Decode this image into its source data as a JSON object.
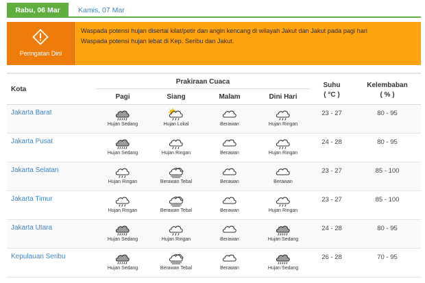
{
  "tabs": [
    {
      "label": "Rabu, 06 Mar",
      "active": true
    },
    {
      "label": "Kamis, 07 Mar",
      "active": false
    }
  ],
  "alert": {
    "label": "Peringatan Dini",
    "icon": "warning-icon",
    "lines": [
      "Waspada potensi hujan disertai kilat/petir dan angin kencang di wilayah Jakut dan Jakut pada pagi hari",
      "Waspada potensi hujan lebat di Kep. Seribu dan Jakut."
    ]
  },
  "table": {
    "headers": {
      "city": "Kota",
      "forecast": "Prakiraan Cuaca",
      "periods": [
        "Pagi",
        "Siang",
        "Malam",
        "Dini Hari"
      ],
      "temp": "Suhu",
      "temp_unit": "( °C )",
      "humidity": "Kelembaban",
      "humidity_unit": "( % )"
    },
    "rows": [
      {
        "city": "Jakarta Barat",
        "forecast": [
          {
            "icon": "heavy-rain",
            "label": "Hujan Sedang"
          },
          {
            "icon": "sun-rain",
            "label": "Hujan Lokal"
          },
          {
            "icon": "cloud",
            "label": "Berawan"
          },
          {
            "icon": "light-rain",
            "label": "Hujan Ringan"
          }
        ],
        "temp": "23 - 27",
        "humidity": "80 - 95"
      },
      {
        "city": "Jakarta Pusat",
        "forecast": [
          {
            "icon": "heavy-rain",
            "label": "Hujan Sedang"
          },
          {
            "icon": "light-rain",
            "label": "Hujan Ringan"
          },
          {
            "icon": "cloud",
            "label": "Berawan"
          },
          {
            "icon": "light-rain",
            "label": "Hujan Ringan"
          }
        ],
        "temp": "24 - 28",
        "humidity": "80 - 95"
      },
      {
        "city": "Jakarta Selatan",
        "forecast": [
          {
            "icon": "light-rain",
            "label": "Hujan Ringan"
          },
          {
            "icon": "overcast",
            "label": "Berawan Tebal"
          },
          {
            "icon": "cloud",
            "label": "Berawan"
          },
          {
            "icon": "cloud",
            "label": "Berawan"
          }
        ],
        "temp": "23 - 27",
        "humidity": "85 - 100"
      },
      {
        "city": "Jakarta Timur",
        "forecast": [
          {
            "icon": "light-rain",
            "label": "Hujan Ringan"
          },
          {
            "icon": "overcast",
            "label": "Berawan Tebal"
          },
          {
            "icon": "cloud",
            "label": "Berawan"
          },
          {
            "icon": "light-rain",
            "label": "Hujan Ringan"
          }
        ],
        "temp": "23 - 27",
        "humidity": "85 - 100"
      },
      {
        "city": "Jakarta Utara",
        "forecast": [
          {
            "icon": "heavy-rain",
            "label": "Hujan Sedang"
          },
          {
            "icon": "light-rain",
            "label": "Hujan Ringan"
          },
          {
            "icon": "cloud",
            "label": "Berawan"
          },
          {
            "icon": "heavy-rain",
            "label": "Hujan Sedang"
          }
        ],
        "temp": "24 - 28",
        "humidity": "80 - 95"
      },
      {
        "city": "Kepulauan Seribu",
        "forecast": [
          {
            "icon": "heavy-rain",
            "label": "Hujan Sedang"
          },
          {
            "icon": "overcast",
            "label": "Berawan Tebal"
          },
          {
            "icon": "cloud",
            "label": "Berawan"
          },
          {
            "icon": "heavy-rain",
            "label": "Hujan Sedang"
          }
        ],
        "temp": "26 - 28",
        "humidity": "70 - 95"
      }
    ]
  },
  "colors": {
    "tab_active": "#5fae3f",
    "link": "#3b84c8",
    "alert_bg": "#ffa30f",
    "alert_badge": "#ee7c0b"
  }
}
